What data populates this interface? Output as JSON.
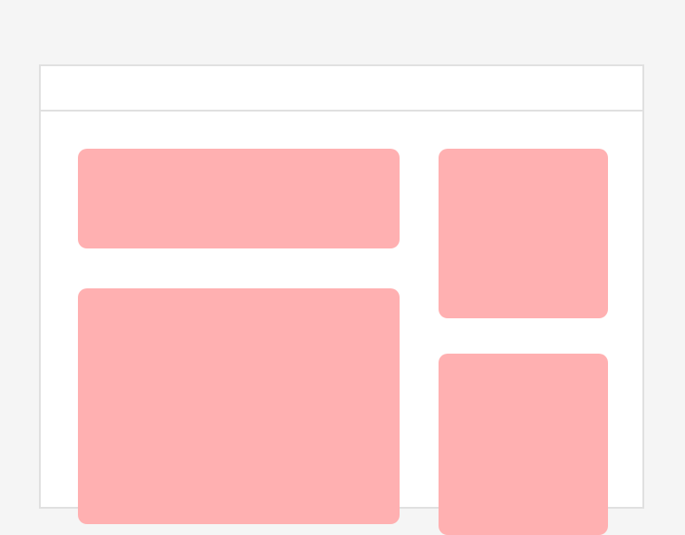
{
  "colors": {
    "page_background": "#f5f5f5",
    "window_background": "#ffffff",
    "border": "#e0e0e0",
    "placeholder_block": "#ffb0b1"
  },
  "layout": {
    "header": {
      "title": ""
    },
    "blocks": [
      {
        "id": "main-top",
        "label": ""
      },
      {
        "id": "main-bottom",
        "label": ""
      },
      {
        "id": "side-top",
        "label": ""
      },
      {
        "id": "side-bottom",
        "label": ""
      }
    ]
  }
}
